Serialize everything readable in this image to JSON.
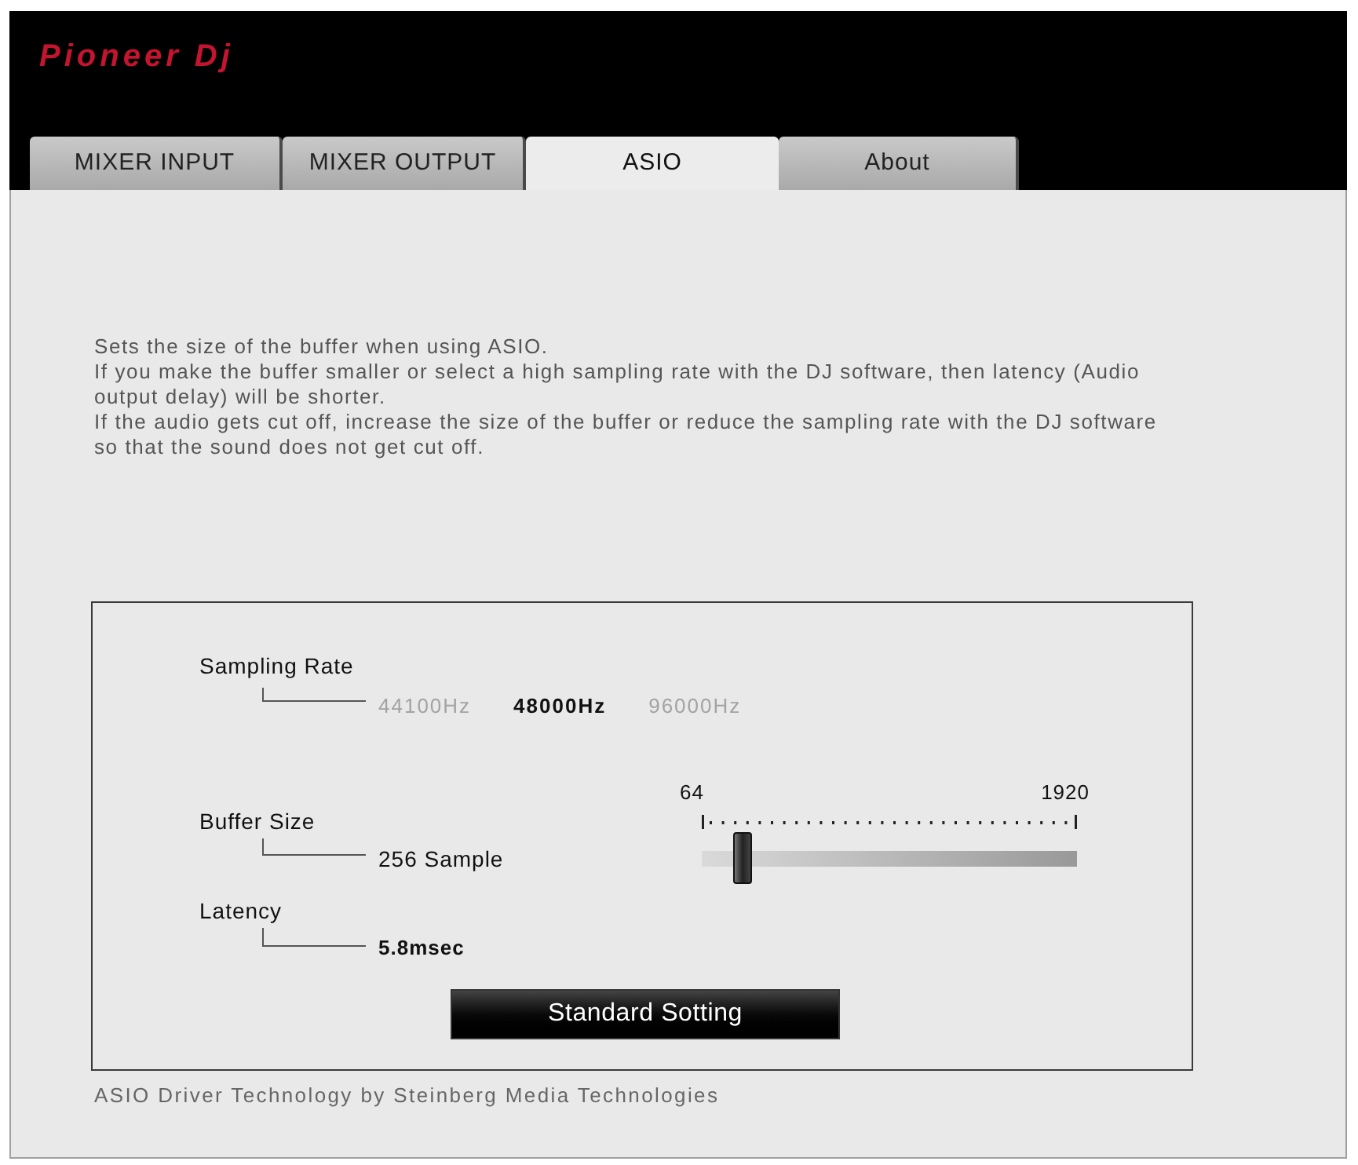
{
  "header": {
    "logo": "Pioneer Dj"
  },
  "tabs": [
    {
      "label": "MIXER INPUT",
      "selected": false
    },
    {
      "label": "MIXER OUTPUT",
      "selected": false
    },
    {
      "label": "ASIO",
      "selected": true
    },
    {
      "label": "About",
      "selected": false
    }
  ],
  "description": [
    "Sets the size of the buffer when using ASIO.",
    "If you make the buffer smaller or select a high sampling rate with the DJ software, then latency (Audio output delay) will be shorter.",
    "If the audio gets cut off, increase the size of the buffer or reduce the sampling rate with the DJ software so that the sound does not get cut off."
  ],
  "sampling_rate": {
    "label": "Sampling Rate",
    "options": [
      {
        "label": "44100Hz",
        "selected": false
      },
      {
        "label": "48000Hz",
        "selected": true
      },
      {
        "label": "96000Hz",
        "selected": false
      }
    ]
  },
  "buffer_size": {
    "label": "Buffer Size",
    "value": "256 Sample",
    "slider": {
      "min_label": "64",
      "max_label": "1920",
      "level": 0.11
    }
  },
  "latency": {
    "label": "Latency",
    "value": "5.8msec"
  },
  "button": {
    "label": "Standard Sotting"
  },
  "footer": "ASIO Driver Technology by Steinberg Media Technologies"
}
